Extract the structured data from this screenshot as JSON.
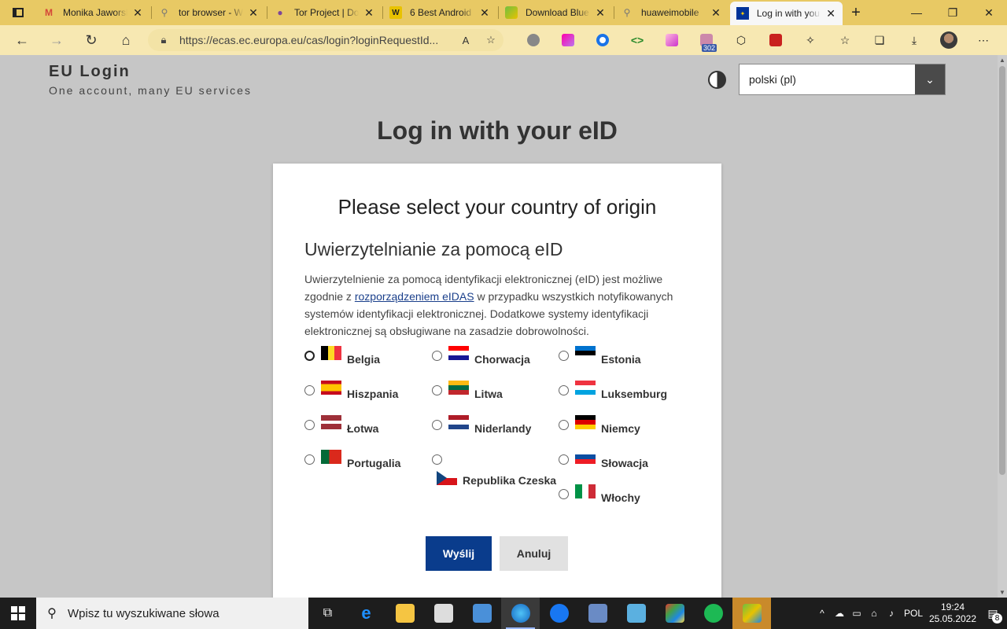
{
  "browser": {
    "tabs": [
      {
        "title": "Monika Jaworska",
        "favicon": "gmail-icon",
        "color": "#d44638"
      },
      {
        "title": "tor browser - W",
        "favicon": "search-icon",
        "color": "#888888"
      },
      {
        "title": "Tor Project | Do",
        "favicon": "onion-icon",
        "color": "#7d4698"
      },
      {
        "title": "6 Best Android",
        "favicon": "w-icon",
        "color": "#e8c200"
      },
      {
        "title": "Download Blue",
        "favicon": "bluestacks-icon",
        "color": "#6fbf40"
      },
      {
        "title": "huaweimobile",
        "favicon": "search-icon",
        "color": "#888888"
      },
      {
        "title": "Log in with you",
        "favicon": "eu-flag-icon",
        "color": "#003399"
      }
    ],
    "url": "https://ecas.ec.europa.eu/cas/login?loginRequestId...",
    "extension_badge": "302"
  },
  "page": {
    "brand_title": "EU Login",
    "brand_subtitle": "One account, many EU services",
    "language": "polski (pl)",
    "heading": "Log in with your eID",
    "card": {
      "title": "Please select your country of origin",
      "subtitle": "Uwierzytelnianie za pomocą eID",
      "desc_before": "Uwierzytelnienie za pomocą identyfikacji elektronicznej (eID) jest możliwe zgodnie z ",
      "desc_link": "rozporządzeniem eIDAS",
      "desc_after": " w przypadku wszystkich notyfikowanych systemów identyfikacji elektronicznej. Dodatkowe systemy identyfikacji elektronicznej są obsługiwane na zasadzie dobrowolności.",
      "countries": [
        "Belgia",
        "Chorwacja",
        "Estonia",
        "Hiszpania",
        "Litwa",
        "Luksemburg",
        "Łotwa",
        "Niderlandy",
        "Niemcy",
        "Portugalia",
        "Republika Czeska",
        "Słowacja",
        "Włochy"
      ],
      "submit": "Wyślij",
      "cancel": "Anuluj"
    }
  },
  "taskbar": {
    "search_placeholder": "Wpisz tu wyszukiwane słowa",
    "language": "POL",
    "time": "19:24",
    "date": "25.05.2022",
    "notifications": "8"
  }
}
